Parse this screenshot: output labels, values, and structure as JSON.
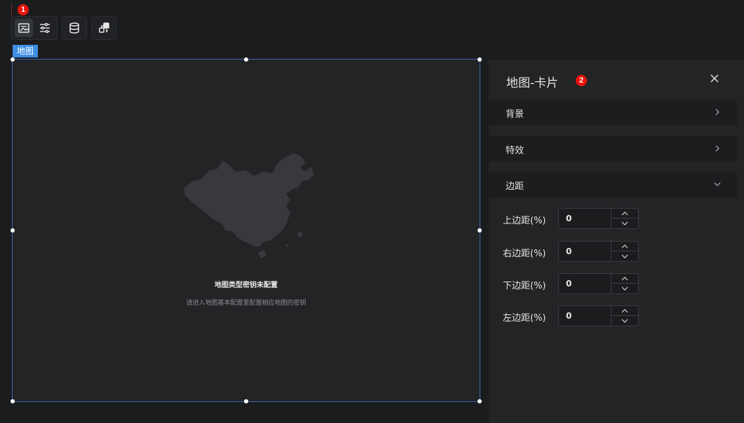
{
  "badges": {
    "toolbar": "1",
    "panel": "2"
  },
  "toolbar": {
    "icons": [
      "image-icon",
      "sliders-icon",
      "database-icon",
      "interaction-icon"
    ]
  },
  "canvas": {
    "tag": "地图",
    "empty_title": "地图类型密钥未配置",
    "empty_desc": "请进入地图基本配置里配置相应地图的密钥"
  },
  "panel": {
    "title": "地图-卡片",
    "sections": [
      {
        "label": "背景",
        "state": "collapsed"
      },
      {
        "label": "特效",
        "state": "collapsed"
      },
      {
        "label": "边距",
        "state": "expanded"
      }
    ],
    "fields": [
      {
        "label": "上边距(%)",
        "value": "0"
      },
      {
        "label": "右边距(%)",
        "value": "0"
      },
      {
        "label": "下边距(%)",
        "value": "0"
      },
      {
        "label": "左边距(%)",
        "value": "0"
      }
    ]
  },
  "colors": {
    "accent": "#3f8fe3",
    "badge": "#e8120c",
    "background": "#1b1c1e",
    "panel": "#232426"
  }
}
